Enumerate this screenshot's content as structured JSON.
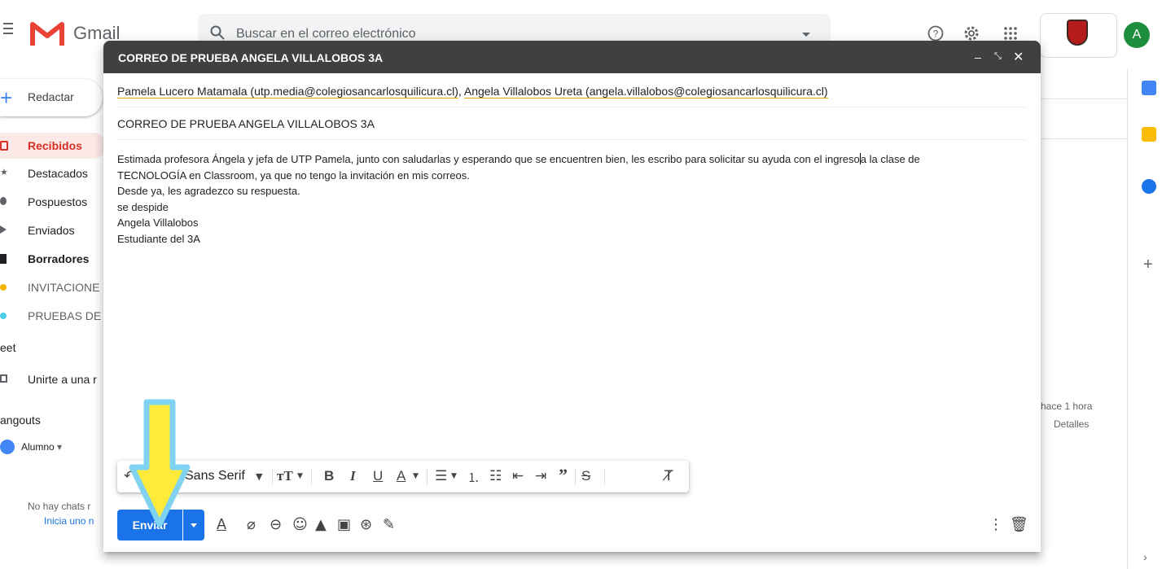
{
  "app": {
    "logo_text": "Gmail",
    "search_placeholder": "Buscar en el correo electrónico",
    "avatar_letter": "A"
  },
  "sidebar": {
    "compose_label": "Redactar",
    "items": [
      {
        "label": "Recibidos",
        "active": true
      },
      {
        "label": "Destacados"
      },
      {
        "label": "Pospuestos"
      },
      {
        "label": "Enviados"
      },
      {
        "label": "Borradores",
        "bold": true
      },
      {
        "label": "INVITACIONE"
      },
      {
        "label": "PRUEBAS DE"
      }
    ],
    "meet_label": "eet",
    "meet_item": "Unirte a una r",
    "hangouts_label": "angouts",
    "user_label": "Alumno",
    "no_chats": "No hay chats r",
    "start_chat": "Inicia uno n"
  },
  "background": {
    "time": "hace 1 hora",
    "details": "Detalles"
  },
  "compose": {
    "title": "CORREO DE PRUEBA ANGELA VILLALOBOS 3A",
    "recipients": [
      "Pamela Lucero Matamala (utp.media@colegiosancarlosquilicura.cl)",
      "Angela Villalobos Ureta (angela.villalobos@colegiosancarlosquilicura.cl)"
    ],
    "recipient_separator": ", ",
    "subject": "CORREO DE PRUEBA ANGELA VILLALOBOS 3A",
    "body_line1_a": "Estimada profesora Ángela y jefa de UTP Pamela, junto con saludarlas y esperando que se encuentren bien, les escribo para solicitar su ayuda con el ingreso",
    "body_line1_b": "a la clase de",
    "body_lines": [
      "TECNOLOGÍA en Classroom, ya que no tengo la invitación en mis correos.",
      "Desde ya, les agradezco su respuesta.",
      "se despide",
      "Angela Villalobos",
      "Estudiante del 3A"
    ],
    "font_name": "Sans Serif",
    "send_label": "Enviar"
  },
  "colors": {
    "send_button": "#1a73e8",
    "header_bar": "#404040",
    "arrow_fill": "#ffeb3b",
    "arrow_outline": "#7fd3f0"
  }
}
